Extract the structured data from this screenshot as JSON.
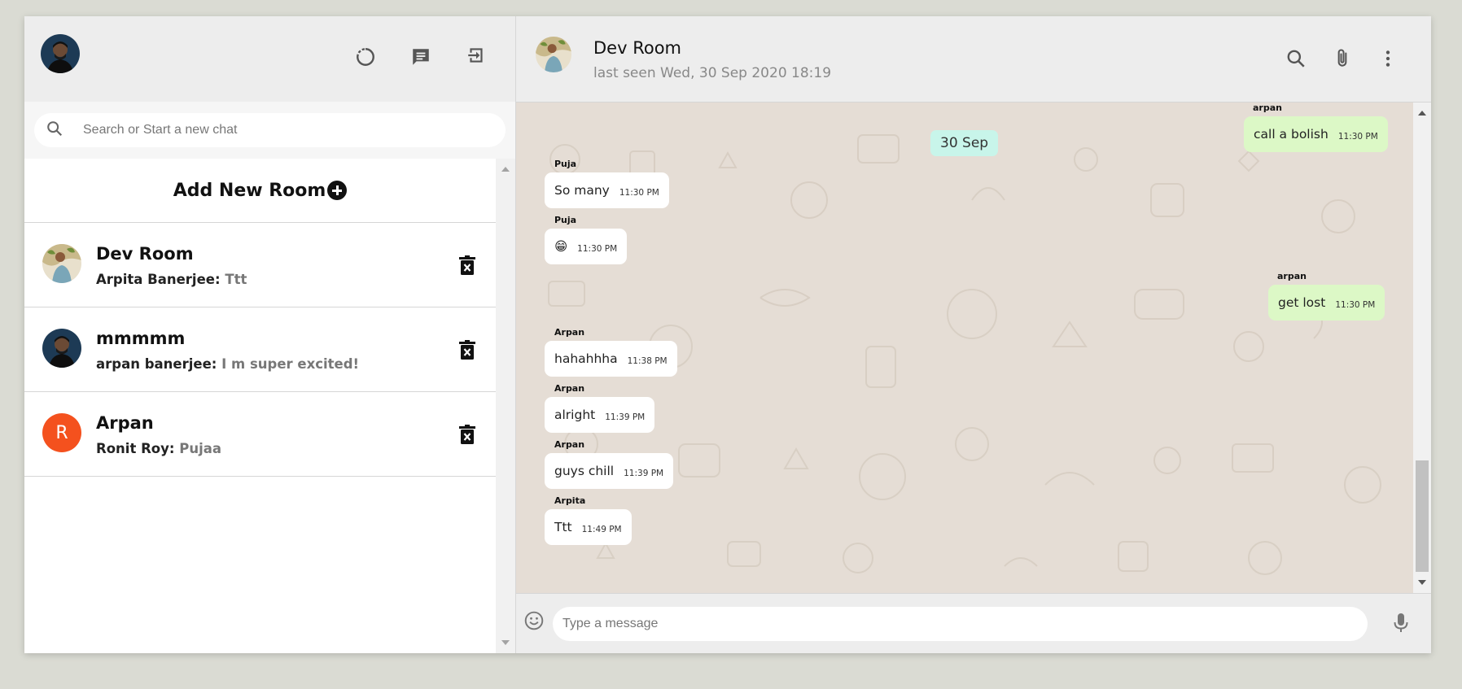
{
  "sidebar": {
    "search_placeholder": "Search or Start a new chat",
    "add_room_label": "Add New Room",
    "chats": [
      {
        "name": "Dev Room",
        "last_sender": "Arpita Banerjee:",
        "last_message": "Ttt",
        "avatar": "photo-plant"
      },
      {
        "name": "mmmmm",
        "last_sender": "arpan banerjee:",
        "last_message": "I m super excited!",
        "avatar": "photo-person"
      },
      {
        "name": "Arpan",
        "last_sender": "Ronit Roy:",
        "last_message": "Pujaa",
        "avatar_letter": "R",
        "avatar_color": "#f4511e"
      }
    ]
  },
  "chat": {
    "title": "Dev Room",
    "subtitle": "last seen Wed, 30 Sep 2020 18:19",
    "date_chip": "30 Sep",
    "messages": [
      {
        "sender": "arpan",
        "text": "call a bolish",
        "time": "11:30 PM",
        "sent": true
      },
      {
        "sender": "Puja",
        "text": "So many",
        "time": "11:30 PM",
        "sent": false
      },
      {
        "sender": "Puja",
        "text": "😁",
        "time": "11:30 PM",
        "sent": false
      },
      {
        "sender": "arpan",
        "text": "get lost",
        "time": "11:30 PM",
        "sent": true
      },
      {
        "sender": "Arpan",
        "text": "hahahhha",
        "time": "11:38 PM",
        "sent": false
      },
      {
        "sender": "Arpan",
        "text": "alright",
        "time": "11:39 PM",
        "sent": false
      },
      {
        "sender": "Arpan",
        "text": "guys chill",
        "time": "11:39 PM",
        "sent": false
      },
      {
        "sender": "Arpita",
        "text": "Ttt",
        "time": "11:49 PM",
        "sent": false
      }
    ],
    "input_placeholder": "Type a message"
  },
  "colors": {
    "sent_bubble": "#dcf8c6",
    "received_bubble": "#ffffff",
    "date_chip": "#c8f5ea",
    "chat_bg": "#e5ddd5",
    "header_bg": "#ededed"
  },
  "icons": {
    "status": "status-icon",
    "new_chat": "chat-icon",
    "logout": "logout-icon",
    "search": "search-icon",
    "attach": "paperclip-icon",
    "menu": "more-vertical-icon",
    "delete": "trash-icon",
    "emoji": "emoji-icon",
    "mic": "mic-icon"
  }
}
